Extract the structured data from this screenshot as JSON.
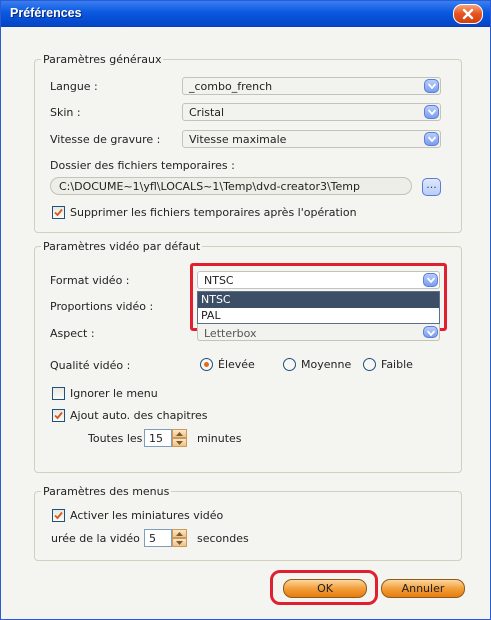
{
  "window": {
    "title": "Préférences"
  },
  "general": {
    "legend": "Paramètres généraux",
    "language_label": "Langue :",
    "language_value": "_combo_french",
    "skin_label": "Skin :",
    "skin_value": "Cristal",
    "burn_speed_label": "Vitesse de gravure :",
    "burn_speed_value": "Vitesse maximale",
    "temp_folder_label": "Dossier des fichiers temporaires :",
    "temp_folder_value": "C:\\DOCUME~1\\yfl\\LOCALS~1\\Temp\\dvd-creator3\\Temp",
    "browse_label": "...",
    "delete_temp_label": "Supprimer les fichiers temporaires après l'opération",
    "delete_temp_checked": true
  },
  "video": {
    "legend": "Paramètres vidéo par défaut",
    "format_label": "Format vidéo :",
    "format_value": "NTSC",
    "format_options": [
      "NTSC",
      "PAL"
    ],
    "ratio_label": "Proportions vidéo :",
    "aspect_label": "Aspect :",
    "aspect_value": "Letterbox",
    "quality_label": "Qualité vidéo :",
    "quality_options": [
      "Élevée",
      "Moyenne",
      "Faible"
    ],
    "quality_selected": "Élevée",
    "ignore_menu_label": "Ignorer le menu",
    "ignore_menu_checked": false,
    "auto_chapters_label": "Ajout auto. des chapitres",
    "auto_chapters_checked": true,
    "every_label": "Toutes les",
    "every_value": "15",
    "minutes_label": "minutes"
  },
  "menus": {
    "legend": "Paramètres des menus",
    "thumbnails_label": "Activer les miniatures vidéo",
    "thumbnails_checked": true,
    "duration_label": "urée de la vidéo",
    "duration_value": "5",
    "seconds_label": "secondes"
  },
  "buttons": {
    "ok": "OK",
    "cancel": "Annuler"
  },
  "colors": {
    "titlebar": "#0a58e0",
    "highlight": "#e0202e",
    "button": "#f39f3a"
  }
}
